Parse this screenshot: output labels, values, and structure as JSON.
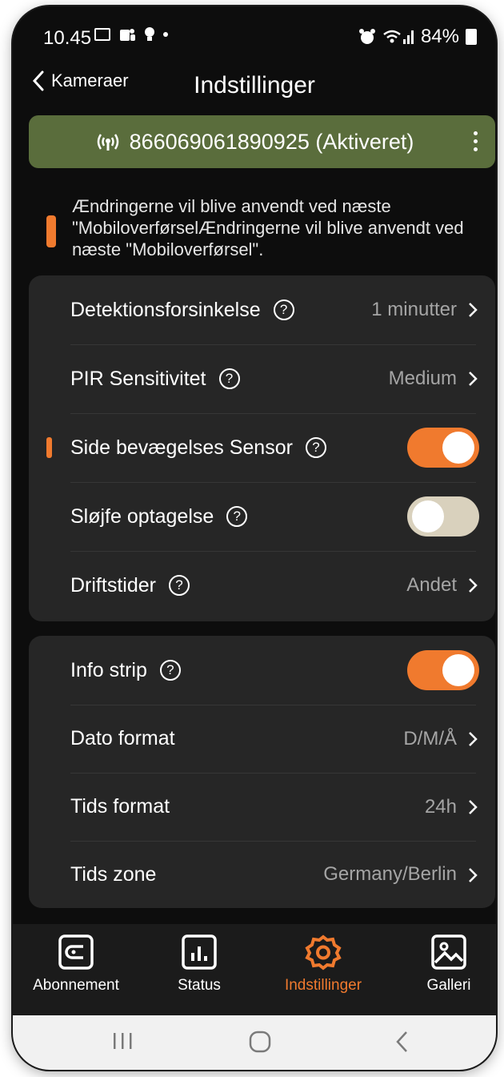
{
  "status_bar": {
    "time": "10.45",
    "battery": "84%"
  },
  "header": {
    "back_label": "Kameraer",
    "title": "Indstillinger"
  },
  "device": {
    "label": "866069061890925 (Aktiveret)",
    "accent_color": "#5a6d3c"
  },
  "notice": {
    "text": "Ændringerne vil blive anvendt ved næste \"MobiloverførselÆndringerne vil blive anvendt ved næste \"Mobiloverførsel\"."
  },
  "settings_group_1": [
    {
      "label": "Detektionsforsinkelse",
      "value": "1 minutter"
    },
    {
      "label": "PIR Sensitivitet",
      "value": "Medium"
    },
    {
      "label": "Side bevægelses Sensor",
      "toggle": "on"
    },
    {
      "label": "Sløjfe optagelse",
      "toggle": "off"
    },
    {
      "label": "Driftstider",
      "value": "Andet"
    }
  ],
  "settings_group_2": [
    {
      "label": "Info strip",
      "toggle": "on"
    },
    {
      "label": "Dato format",
      "value": "D/M/Å"
    },
    {
      "label": "Tids format",
      "value": "24h"
    },
    {
      "label": "Tids zone",
      "value": "Germany/Berlin"
    }
  ],
  "bottom_nav": {
    "tabs": [
      {
        "label": "Abonnement",
        "icon": "subscription-icon"
      },
      {
        "label": "Status",
        "icon": "chart-icon"
      },
      {
        "label": "Indstillinger",
        "icon": "gear-icon",
        "active": true
      },
      {
        "label": "Galleri",
        "icon": "image-icon"
      }
    ]
  },
  "colors": {
    "accent": "#f07a2e",
    "card": "#262626",
    "background": "#0d0d0d"
  }
}
